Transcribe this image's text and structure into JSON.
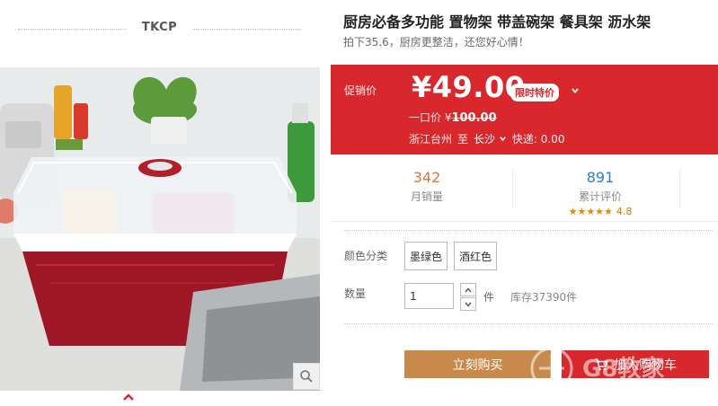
{
  "brand": "TKCP",
  "product": {
    "title": "厨房必备多功能 置物架 带盖碗架 餐具架 沥水架",
    "subtitle": "拍下35.6，厨房更整洁，还您好心情！"
  },
  "price": {
    "label": "促销价",
    "current": "¥49.00",
    "badge": "限时特价",
    "original_label": "一口价 ¥",
    "original_value": "100.00",
    "ship_from": "浙江台州",
    "ship_to_label": "至",
    "ship_to": "长沙",
    "shipping": "快递: 0.00"
  },
  "stats": {
    "sales_count": "342",
    "sales_label": "月销量",
    "reviews_count": "891",
    "reviews_label": "累计评价",
    "stars": "★★★★★",
    "rating": "4.8"
  },
  "options": {
    "color_label": "颜色分类",
    "colors": [
      "墨绿色",
      "酒红色"
    ],
    "qty_label": "数量",
    "qty_value": "1",
    "unit": "件",
    "stock": "库存37390件"
  },
  "actions": {
    "buy_now": "立刻购买",
    "add_to_cart": "加入购物车"
  },
  "watermark": "G8教家",
  "colors": {
    "accent_red": "#d9282d",
    "buy_button": "#c88a4a",
    "reviews_blue": "#2a7fd0",
    "sales_orange": "#d47a3a"
  }
}
